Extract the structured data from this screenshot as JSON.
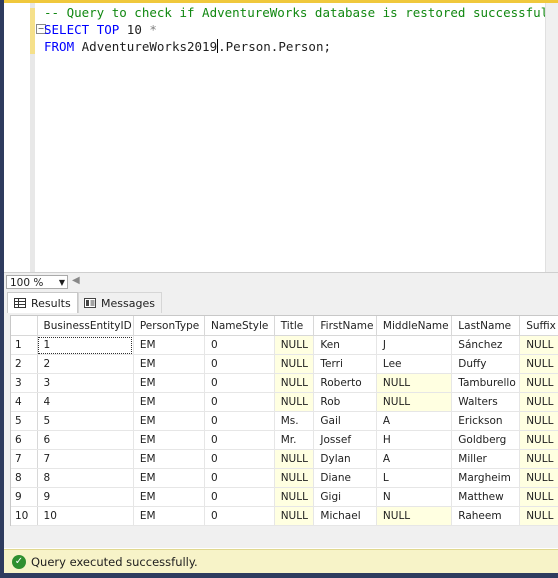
{
  "editor": {
    "comment_line": "-- Query to check if AdventureWorks database is restored successfully",
    "line2": {
      "kw1": "SELECT",
      "kw2": "TOP",
      "num": "10",
      "star": "*"
    },
    "line3": {
      "kw": "FROM",
      "db": "AdventureWorks2019",
      "rest": ".Person.Person;"
    }
  },
  "zoom": {
    "value": "100 %"
  },
  "tabs": {
    "results": "Results",
    "messages": "Messages"
  },
  "grid": {
    "columns": [
      "BusinessEntityID",
      "PersonType",
      "NameStyle",
      "Title",
      "FirstName",
      "MiddleName",
      "LastName",
      "Suffix"
    ],
    "rows": [
      [
        "1",
        "1",
        "EM",
        "0",
        "NULL",
        "Ken",
        "J",
        "Sánchez",
        "NULL"
      ],
      [
        "2",
        "2",
        "EM",
        "0",
        "NULL",
        "Terri",
        "Lee",
        "Duffy",
        "NULL"
      ],
      [
        "3",
        "3",
        "EM",
        "0",
        "NULL",
        "Roberto",
        "NULL",
        "Tamburello",
        "NULL"
      ],
      [
        "4",
        "4",
        "EM",
        "0",
        "NULL",
        "Rob",
        "NULL",
        "Walters",
        "NULL"
      ],
      [
        "5",
        "5",
        "EM",
        "0",
        "Ms.",
        "Gail",
        "A",
        "Erickson",
        "NULL"
      ],
      [
        "6",
        "6",
        "EM",
        "0",
        "Mr.",
        "Jossef",
        "H",
        "Goldberg",
        "NULL"
      ],
      [
        "7",
        "7",
        "EM",
        "0",
        "NULL",
        "Dylan",
        "A",
        "Miller",
        "NULL"
      ],
      [
        "8",
        "8",
        "EM",
        "0",
        "NULL",
        "Diane",
        "L",
        "Margheim",
        "NULL"
      ],
      [
        "9",
        "9",
        "EM",
        "0",
        "NULL",
        "Gigi",
        "N",
        "Matthew",
        "NULL"
      ],
      [
        "10",
        "10",
        "EM",
        "0",
        "NULL",
        "Michael",
        "NULL",
        "Raheem",
        "NULL"
      ]
    ]
  },
  "status": {
    "text": "Query executed successfully."
  },
  "colors": {
    "comment": "#118811",
    "keyword": "#0000ff",
    "null_cell": "#ffffe1",
    "status_bar": "#f7f3c8",
    "success": "#2f8f2f"
  }
}
